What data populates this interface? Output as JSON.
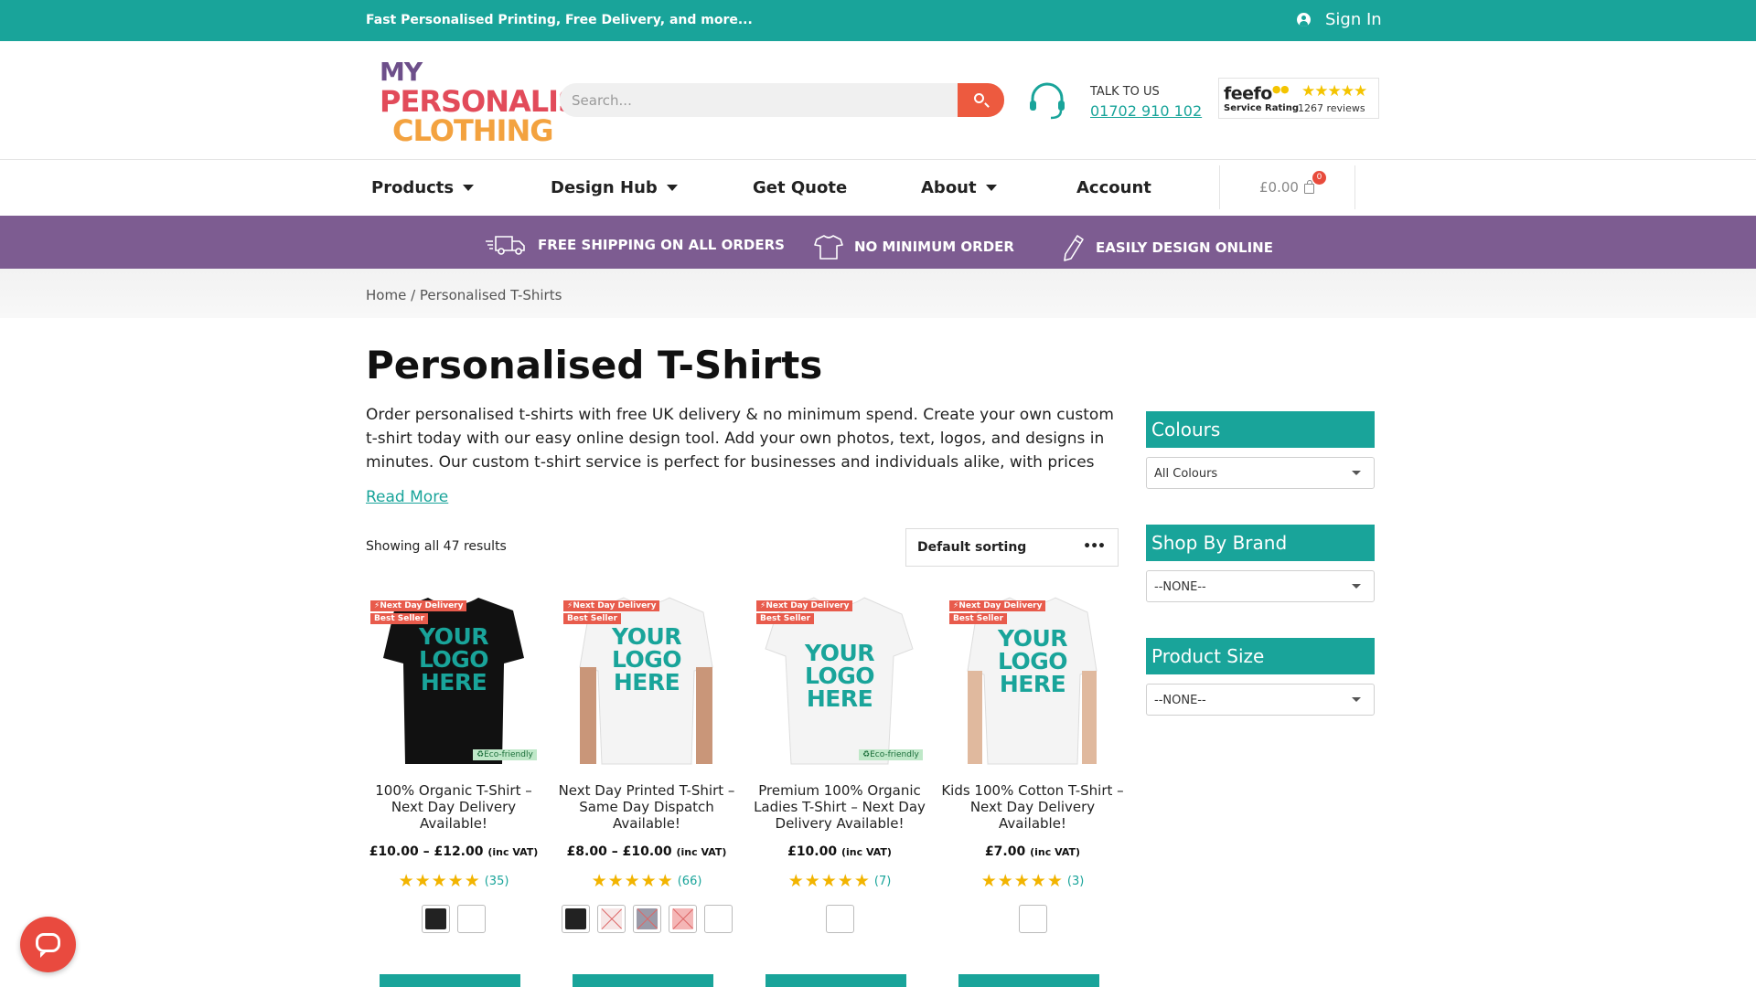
{
  "topbar": {
    "promo": "Fast Personalised Printing, Free Delivery, and more...",
    "sign_in": "Sign In"
  },
  "header": {
    "logo_lines": [
      "MY",
      "PERSONALISED",
      "CLOTHING"
    ],
    "search_placeholder": "Search...",
    "talk_label": "TALK TO US",
    "phone": "01702 910 102",
    "feefo": {
      "brand": "feefo",
      "service_rating": "Service Rating",
      "stars": "★★★★★",
      "reviews": "1267 reviews"
    }
  },
  "nav": {
    "products": "Products",
    "design_hub": "Design Hub",
    "get_quote": "Get Quote",
    "about": "About",
    "account": "Account",
    "cart_total": "£0.00",
    "cart_count": "0"
  },
  "benefits": {
    "shipping": "FREE SHIPPING ON ALL ORDERS",
    "minimum": "NO MINIMUM ORDER",
    "design": "EASILY DESIGN ONLINE"
  },
  "breadcrumb": {
    "home": "Home",
    "separator": " / ",
    "current": "Personalised T-Shirts"
  },
  "page": {
    "title": "Personalised T-Shirts",
    "description": "Order personalised t-shirts with free UK delivery & no minimum spend. Create your own custom t-shirt today with our easy online design tool. Add your own photos, text, logos, and designs in minutes. Our custom t-shirt service is perfect for businesses and individuals alike, with prices",
    "read_more": "Read More",
    "results_count": "Showing all 47 results",
    "sort_label": "Default sorting",
    "sort_icon": "•••"
  },
  "products": [
    {
      "name": "100% Organic T-Shirt – Next Day Delivery Available!",
      "price": "£10.00 – £12.00",
      "vat": "(inc VAT)",
      "stars": "★★★★★",
      "reviews": "(35)",
      "tag1": "⚡Next Day Delivery",
      "tag2": "Best Seller",
      "eco": "♻Eco-friendly",
      "shirt_color": "#111111",
      "logo_text": [
        "YOUR",
        "LOGO",
        "HERE"
      ]
    },
    {
      "name": "Next Day Printed T-Shirt – Same Day Dispatch Available!",
      "price": "£8.00 – £10.00",
      "vat": "(inc VAT)",
      "stars": "★★★★★",
      "reviews": "(66)",
      "tag1": "⚡Next Day Delivery",
      "tag2": "Best Seller",
      "shirt_color": "#f4f4f4",
      "logo_text": [
        "YOUR",
        "LOGO",
        "HERE"
      ]
    },
    {
      "name": "Premium 100% Organic Ladies T-Shirt – Next Day Delivery Available!",
      "price": "£10.00",
      "vat": "(inc VAT)",
      "stars": "★★★★★",
      "reviews": "(7)",
      "tag1": "⚡Next Day Delivery",
      "tag2": "Best Seller",
      "eco": "♻Eco-friendly",
      "shirt_color": "#f4f4f4",
      "logo_text": [
        "YOUR",
        "LOGO",
        "HERE"
      ]
    },
    {
      "name": "Kids 100% Cotton T-Shirt – Next Day Delivery Available!",
      "price": "£7.00",
      "vat": "(inc VAT)",
      "stars": "★★★★★",
      "reviews": "(3)",
      "tag1": "⚡Next Day Delivery",
      "tag2": "Best Seller",
      "shirt_color": "#f4f4f4",
      "logo_text": [
        "YOUR",
        "LOGO",
        "HERE"
      ]
    }
  ],
  "swatch_colors": {
    "black": "#222222",
    "white": "#ffffff",
    "light": "#f6e6e6",
    "grey": "#9a9aa8",
    "pink": "#f4b6b6"
  },
  "sidebar": {
    "colours_title": "Colours",
    "colours_value": "All Colours",
    "brand_title": "Shop By Brand",
    "brand_value": "--NONE--",
    "size_title": "Product Size",
    "size_value": "--NONE--"
  },
  "colors": {
    "teal": "#19a49a",
    "purple": "#7d5c91",
    "orange": "#ed5a3f"
  }
}
